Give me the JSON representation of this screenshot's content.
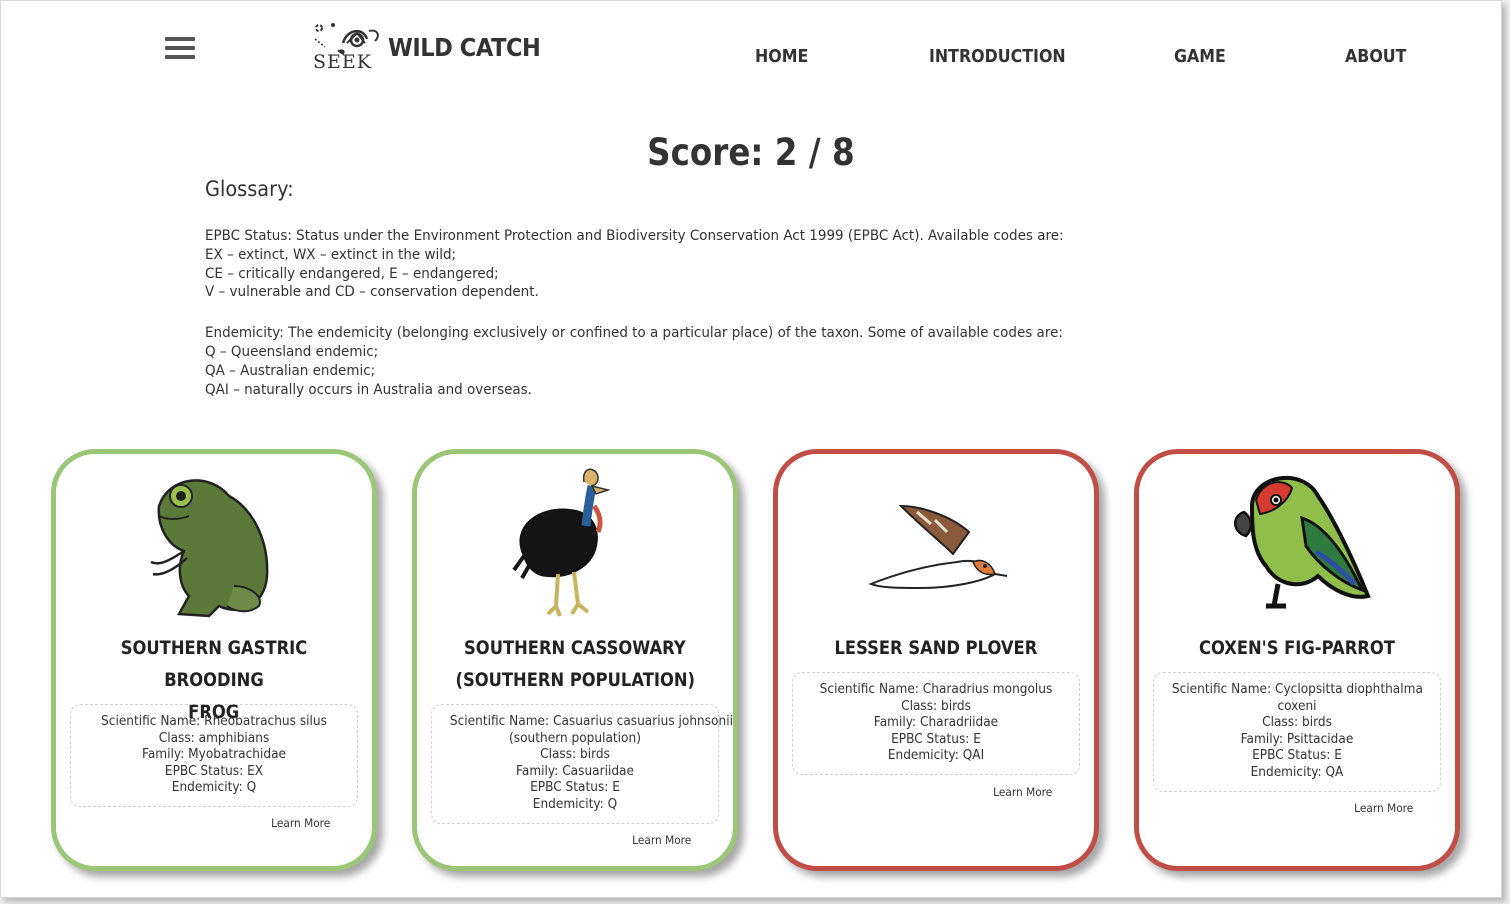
{
  "app": {
    "logo_seek": "SEEK",
    "logo_text": "WILD CATCH"
  },
  "nav": {
    "items": [
      "HOME",
      "INTRODUCTION",
      "GAME",
      "ABOUT"
    ]
  },
  "score": {
    "text": "Score: 2 / 8"
  },
  "glossary": {
    "title": "Glossary:",
    "epbc_lines": [
      "EPBC Status: Status under the Environment Protection and Biodiversity Conservation Act 1999 (EPBC Act). Available codes are:",
      "EX – extinct, WX – extinct in the wild;",
      "CE – critically endangered, E – endangered;",
      "V – vulnerable and CD – conservation dependent."
    ],
    "endemicity_label": "Endemicity:",
    "endemicity_intro": " The endemicity (belonging exclusively or confined to a particular place) of the taxon. Some of available codes are:",
    "endemicity_lines": [
      "Q – Queensland endemic;",
      "QA – Australian endemic;",
      "QAI – naturally occurs in Australia and overseas."
    ]
  },
  "cards": [
    {
      "title_lines": [
        "SOUTHERN GASTRIC BROODING",
        "FROG"
      ],
      "info_lines": [
        "Scientific Name: Rheobatrachus silus",
        "Class: amphibians",
        "Family: Myobatrachidae",
        "EPBC Status: EX",
        "Endemicity: Q"
      ],
      "learn_more": "Learn More",
      "result": "correct",
      "border_color": "#9cc677",
      "icon": "frog-icon"
    },
    {
      "title_lines": [
        "SOUTHERN CASSOWARY",
        "(SOUTHERN POPULATION)"
      ],
      "info_lines": [
        "Scientific Name: Casuarius casuarius johnsonii",
        "(southern population)",
        "Class: birds",
        "Family: Casuariidae",
        "EPBC Status: E",
        "Endemicity: Q"
      ],
      "learn_more": "Learn More",
      "result": "correct",
      "border_color": "#9cc677",
      "icon": "cassowary-icon"
    },
    {
      "title_lines": [
        "LESSER SAND PLOVER"
      ],
      "info_lines": [
        "Scientific Name: Charadrius mongolus",
        "Class: birds",
        "Family: Charadriidae",
        "EPBC Status: E",
        "Endemicity: QAI"
      ],
      "learn_more": "Learn More",
      "result": "wrong",
      "border_color": "#c04e47",
      "icon": "plover-icon"
    },
    {
      "title_lines": [
        "COXEN'S FIG-PARROT"
      ],
      "info_lines": [
        "Scientific Name: Cyclopsitta diophthalma",
        "coxeni",
        "Class: birds",
        "Family: Psittacidae",
        "EPBC Status: E",
        "Endemicity: QA"
      ],
      "learn_more": "Learn More",
      "result": "wrong",
      "border_color": "#c04e47",
      "icon": "fig-parrot-icon"
    }
  ]
}
